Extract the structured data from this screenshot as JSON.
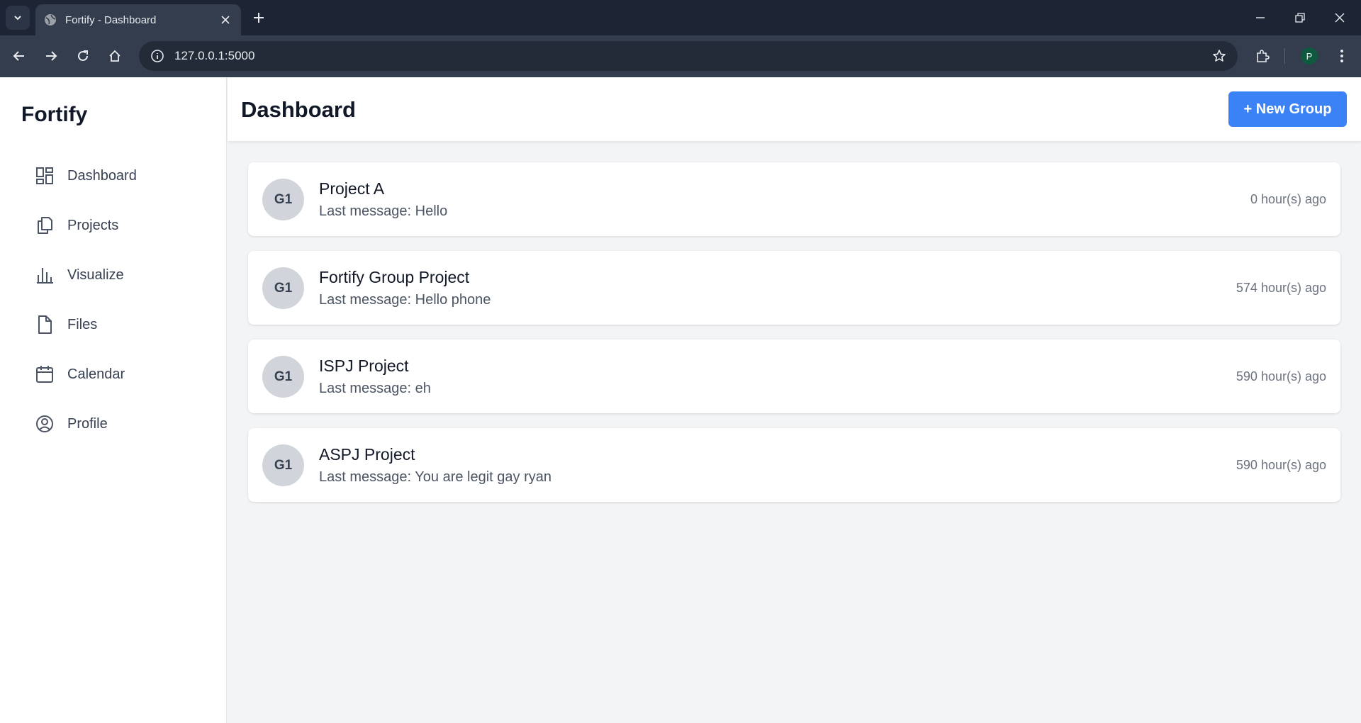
{
  "browser": {
    "tab_title": "Fortify - Dashboard",
    "url": "127.0.0.1:5000",
    "profile_initial": "P"
  },
  "app": {
    "brand": "Fortify",
    "accent_color": "#3b82f6",
    "nav": [
      {
        "label": "Dashboard",
        "icon": "dashboard-icon"
      },
      {
        "label": "Projects",
        "icon": "projects-icon"
      },
      {
        "label": "Visualize",
        "icon": "bar-chart-icon"
      },
      {
        "label": "Files",
        "icon": "file-icon"
      },
      {
        "label": "Calendar",
        "icon": "calendar-icon"
      },
      {
        "label": "Profile",
        "icon": "user-circle-icon"
      }
    ]
  },
  "header": {
    "title": "Dashboard",
    "new_group_label": "+ New Group"
  },
  "groups": [
    {
      "avatar": "G1",
      "name": "Project A",
      "last_message": "Last message: Hello",
      "time": "0 hour(s) ago"
    },
    {
      "avatar": "G1",
      "name": "Fortify Group Project",
      "last_message": "Last message: Hello phone",
      "time": "574 hour(s) ago"
    },
    {
      "avatar": "G1",
      "name": "ISPJ Project",
      "last_message": "Last message: eh",
      "time": "590 hour(s) ago"
    },
    {
      "avatar": "G1",
      "name": "ASPJ Project",
      "last_message": "Last message: You are legit gay ryan",
      "time": "590 hour(s) ago"
    }
  ]
}
